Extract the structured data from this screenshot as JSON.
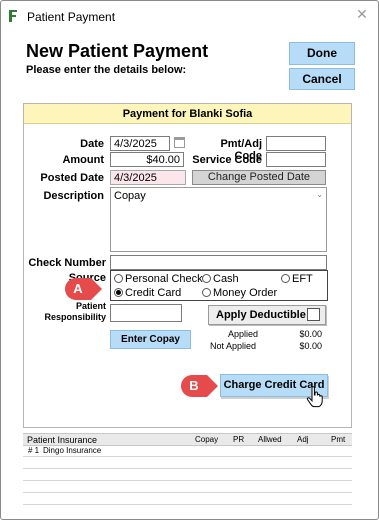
{
  "window": {
    "title": "Patient Payment"
  },
  "header": {
    "title": "New Patient Payment",
    "subtitle": "Please enter the details below:",
    "done_label": "Done",
    "cancel_label": "Cancel"
  },
  "panel": {
    "title": "Payment for Blanki Sofia",
    "date_label": "Date",
    "date_value": "4/3/2025",
    "amount_label": "Amount",
    "amount_value": "$40.00",
    "posted_date_label": "Posted Date",
    "posted_date_value": "4/3/2025",
    "pmt_adj_code_label": "Pmt/Adj Code",
    "pmt_adj_code_value": "",
    "service_code_label": "Service Code",
    "service_code_value": "",
    "change_posted_date_label": "Change Posted Date",
    "description_label": "Description",
    "description_value": "Copay",
    "check_number_label": "Check Number",
    "check_number_value": "",
    "source_label": "Source",
    "source_options": [
      "Personal Check",
      "Cash",
      "EFT",
      "Credit Card",
      "Money Order"
    ],
    "source_selected": "Credit Card",
    "patient_responsibility_label_1": "Patient",
    "patient_responsibility_label_2": "Responsibility",
    "patient_responsibility_value": "",
    "apply_deductible_label": "Apply Deductible",
    "applied_label": "Applied",
    "applied_value": "$0.00",
    "not_applied_label": "Not Applied",
    "not_applied_value": "$0.00",
    "enter_copay_label": "Enter Copay",
    "charge_credit_card_label": "Charge Credit Card"
  },
  "callouts": {
    "a": "A",
    "b": "B"
  },
  "insurance_grid": {
    "columns": [
      "Patient Insurance",
      "Copay",
      "PR",
      "Allwed",
      "Adj",
      "Pmt"
    ],
    "rows": [
      {
        "num": "# 1",
        "name": "Dingo Insurance"
      }
    ]
  },
  "colors": {
    "panel_header": "#fdf5ba",
    "button_blue": "#b7dcf8",
    "callout_red": "#e54b4b",
    "field_pink": "#fbe6ec"
  },
  "icons": [
    "app-icon",
    "close-icon",
    "calendar-icon",
    "scroll-arrow-icon",
    "cursor-hand-icon"
  ]
}
